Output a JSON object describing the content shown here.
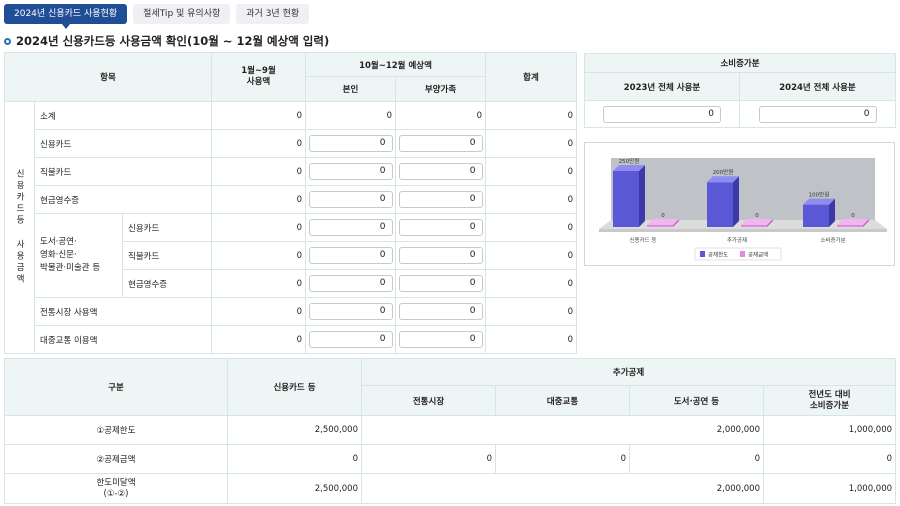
{
  "tabs": [
    {
      "label": "2024년 신용카드 사용현황",
      "active": true
    },
    {
      "label": "절세Tip 및 유의사항",
      "active": false
    },
    {
      "label": "과거 3년 현황",
      "active": false
    }
  ],
  "title": "2024년 신용카드등 사용금액 확인(10월 ~ 12월 예상액 입력)",
  "usage": {
    "h_item": "항목",
    "h_jan_sep": "1월~9월\n사용액",
    "h_oct_dec": "10월~12월 예상액",
    "h_self": "본인",
    "h_dependent": "부양가족",
    "h_total": "합계",
    "group_label": "신용카드등 사용금액",
    "sub_group_label": "도서·공연·\n영화·신문·\n박물관·미술관 등",
    "rows": [
      {
        "label": "소계",
        "jan_sep": "0",
        "self": "0",
        "dep": "0",
        "total": "0"
      },
      {
        "label": "신용카드",
        "jan_sep": "0",
        "self": "0",
        "dep": "0",
        "total": "0"
      },
      {
        "label": "직불카드",
        "jan_sep": "0",
        "self": "0",
        "dep": "0",
        "total": "0"
      },
      {
        "label": "현금영수증",
        "jan_sep": "0",
        "self": "0",
        "dep": "0",
        "total": "0"
      },
      {
        "label": "신용카드",
        "jan_sep": "0",
        "self": "0",
        "dep": "0",
        "total": "0"
      },
      {
        "label": "직불카드",
        "jan_sep": "0",
        "self": "0",
        "dep": "0",
        "total": "0"
      },
      {
        "label": "현금영수증",
        "jan_sep": "0",
        "self": "0",
        "dep": "0",
        "total": "0"
      },
      {
        "label": "전통시장 사용액",
        "jan_sep": "0",
        "self": "0",
        "dep": "0",
        "total": "0"
      },
      {
        "label": "대중교통 이용액",
        "jan_sep": "0",
        "self": "0",
        "dep": "0",
        "total": "0"
      }
    ]
  },
  "increase": {
    "title": "소비증가분",
    "h_2023": "2023년 전체 사용분",
    "h_2024": "2024년 전체 사용분",
    "v_2023": "0",
    "v_2024": "0"
  },
  "chart_data": {
    "type": "bar",
    "categories": [
      "신용카드 등",
      "추가공제",
      "소비증가분"
    ],
    "series": [
      {
        "name": "공제한도",
        "values": [
          2500000,
          2000000,
          1000000
        ],
        "labels": [
          "250만원",
          "200만원",
          "100만원"
        ],
        "color": "#5b5bd6"
      },
      {
        "name": "공제금액",
        "values": [
          0,
          0,
          0
        ],
        "labels": [
          "0",
          "0",
          "0"
        ],
        "color": "#e080e0"
      }
    ],
    "ylim": [
      0,
      2500000
    ]
  },
  "deduction": {
    "h_category": "구분",
    "h_credit": "신용카드 등",
    "h_additional": "추가공제",
    "h_market": "전통시장",
    "h_transit": "대중교통",
    "h_books": "도서·공연 등",
    "h_prev_year": "전년도 대비\n소비증가분",
    "rows": [
      {
        "label": "①공제한도",
        "credit": "2,500,000",
        "merged": "2,000,000",
        "prev": "1,000,000"
      },
      {
        "label": "②공제금액",
        "credit": "0",
        "market": "0",
        "transit": "0",
        "books": "0",
        "prev": "0"
      },
      {
        "label": "한도미달액\n(①-②)",
        "credit": "2,500,000",
        "merged": "2,000,000",
        "prev": "1,000,000"
      }
    ]
  }
}
